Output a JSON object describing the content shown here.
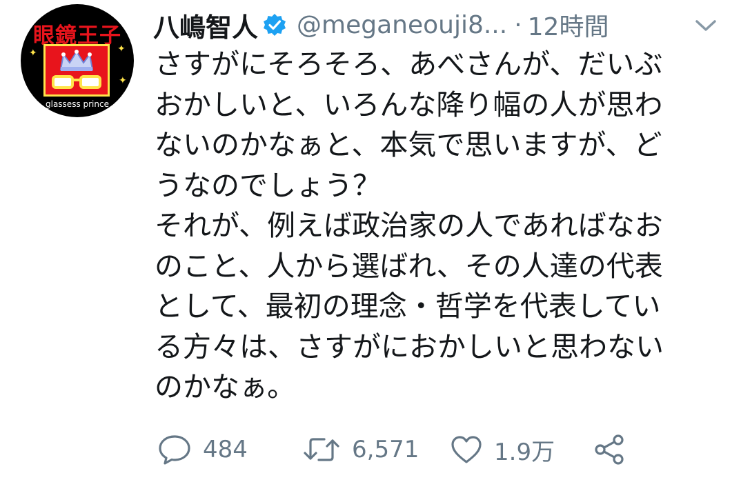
{
  "tweet": {
    "avatar": {
      "title": "眼鏡王子",
      "caption": "glassess prince"
    },
    "author": {
      "display_name": "八嶋智人",
      "handle": "@meganeouji8...",
      "separator": "·",
      "time": "12時間"
    },
    "icons": {
      "verified": "verified-badge-icon",
      "menu": "chevron-down-icon",
      "reply": "reply-bubble-icon",
      "retweet": "retweet-icon",
      "like": "heart-icon",
      "share": "share-icon"
    },
    "colors": {
      "verified_blue": "#1da1f2",
      "muted_gray": "#657786",
      "text": "#14171a",
      "avatar_red": "#e8141c",
      "avatar_yellow": "#ffe44a"
    },
    "text_lines": [
      "さすがにそろそろ、あべさんが、だいぶ",
      "おかしいと、いろんな降り幅の人が思わ",
      "ないのかなぁと、本気で思いますが、ど",
      "うなのでしょう？",
      "それが、例えば政治家の人であればなお",
      "のこと、人から選ばれ、その人達の代表",
      "として、最初の理念・哲学を代表してい",
      "る方々は、さすがにおかしいと思わない",
      "のかなぁ。"
    ],
    "actions": {
      "reply_count": "484",
      "retweet_count": "6,571",
      "like_count": "1.9万"
    }
  }
}
